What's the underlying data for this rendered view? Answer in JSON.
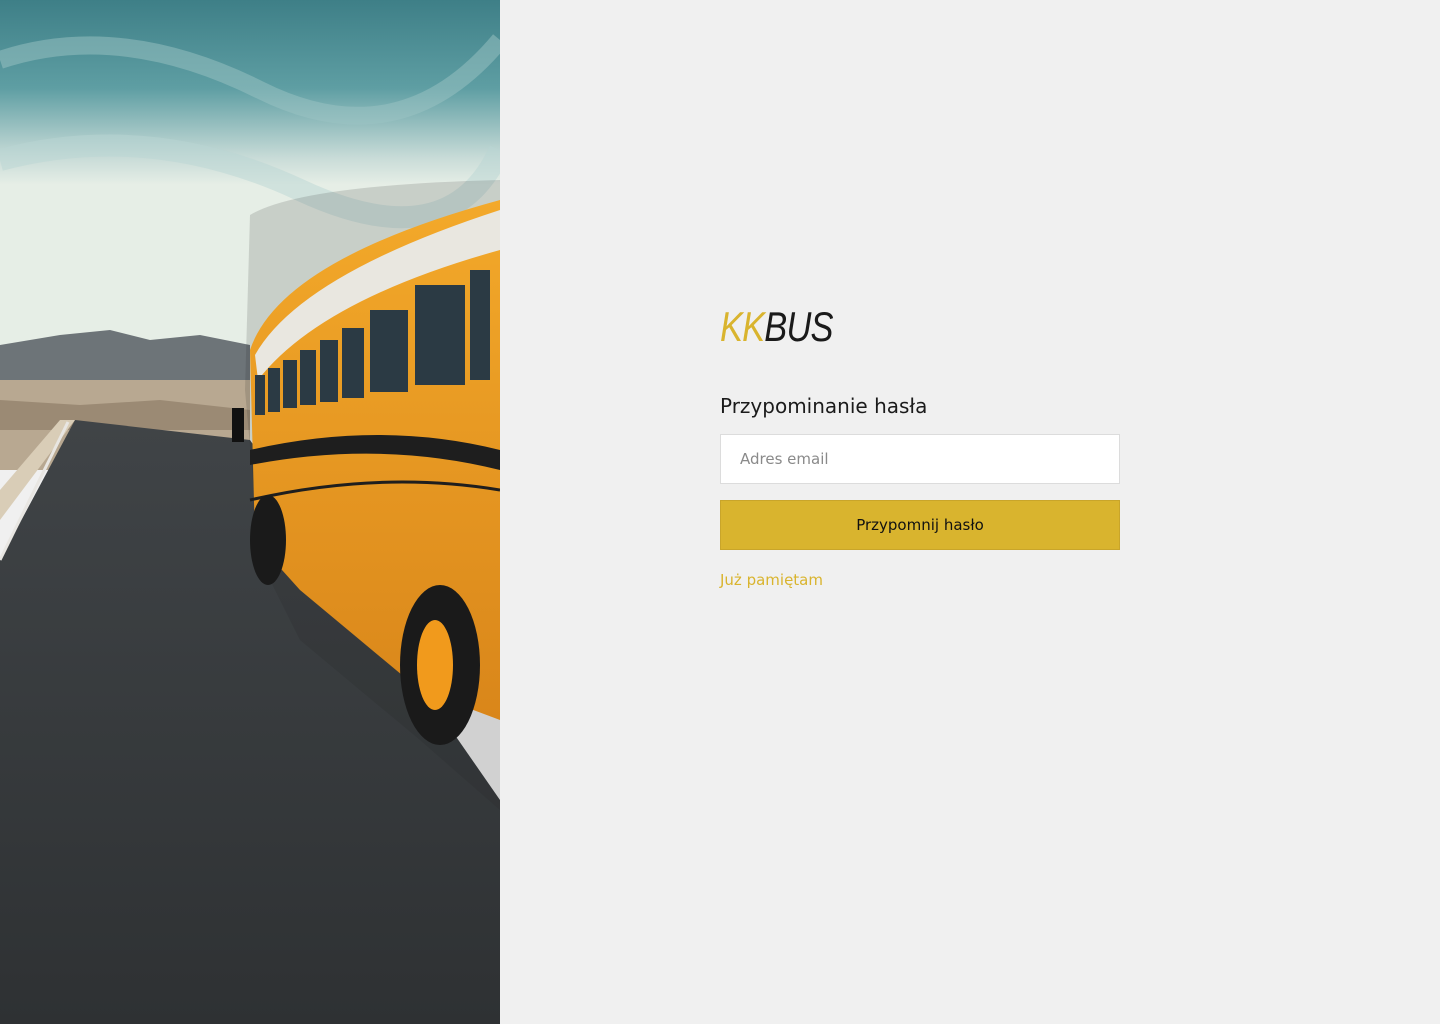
{
  "brand": {
    "part1": "KK",
    "part2": "BUS"
  },
  "form": {
    "title": "Przypominanie hasła",
    "email_placeholder": "Adres email",
    "email_value": "",
    "submit_label": "Przypomnij hasło",
    "back_link_label": "Już pamiętam"
  },
  "colors": {
    "accent": "#d9b42e",
    "background": "#f0f0f0",
    "text": "#1b1b1b"
  },
  "hero": {
    "image": "school-bus-on-desert-road"
  }
}
